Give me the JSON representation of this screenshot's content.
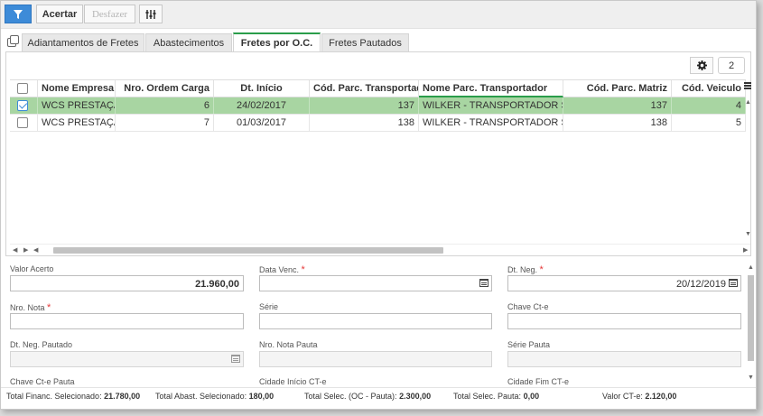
{
  "toolbar": {
    "filter_icon": "filter-icon",
    "acertar_label": "Acertar",
    "desfazer_label": "Desfazer",
    "columns_icon": "sliders-icon"
  },
  "tabs": [
    {
      "label": "Adiantamentos de Fretes",
      "active": false
    },
    {
      "label": "Abastecimentos",
      "active": false
    },
    {
      "label": "Fretes por O.C.",
      "active": true
    },
    {
      "label": "Fretes Pautados",
      "active": false
    }
  ],
  "grid": {
    "gear_icon": "gear-icon",
    "selected_count": "2",
    "columns": [
      "Nome Empresa",
      "Nro. Ordem Carga",
      "Dt. Início",
      "Cód. Parc. Transportador",
      "Nome Parc. Transportador",
      "Cód. Parc. Matriz",
      "Cód. Veiculo"
    ],
    "rows": [
      {
        "checked": true,
        "cells": [
          "WCS PRESTAÇÃO",
          "6",
          "24/02/2017",
          "137",
          "WILKER - TRANSPORTADOR SFRAN",
          "137",
          "4"
        ]
      },
      {
        "checked": false,
        "cells": [
          "WCS PRESTAÇÃO",
          "7",
          "01/03/2017",
          "138",
          "WILKER - TRANSPORTADOR SFRAN",
          "138",
          "5"
        ]
      }
    ]
  },
  "form": {
    "valor_acerto": {
      "label": "Valor Acerto",
      "value": "21.960,00"
    },
    "data_venc": {
      "label": "Data Venc.",
      "value": ""
    },
    "dt_neg": {
      "label": "Dt. Neg.",
      "value": "20/12/2019"
    },
    "nro_nota": {
      "label": "Nro. Nota",
      "value": ""
    },
    "serie": {
      "label": "Série",
      "value": ""
    },
    "chave_cte": {
      "label": "Chave Ct-e",
      "value": ""
    },
    "dt_neg_pautado": {
      "label": "Dt. Neg. Pautado",
      "value": ""
    },
    "nro_nota_pauta": {
      "label": "Nro. Nota Pauta",
      "value": ""
    },
    "serie_pauta": {
      "label": "Série Pauta",
      "value": ""
    },
    "chave_cte_pauta": {
      "label": "Chave Ct-e Pauta"
    },
    "cidade_inicio": {
      "label": "Cidade Início CT-e"
    },
    "cidade_fim": {
      "label": "Cidade Fim CT-e"
    },
    "required_mark": "*"
  },
  "footer": {
    "total_financ_label": "Total Financ. Selecionado:",
    "total_financ_value": "21.780,00",
    "total_abast_label": "Total Abast. Selecionado:",
    "total_abast_value": "180,00",
    "total_oc_label": "Total Selec. (OC - Pauta):",
    "total_oc_value": "2.300,00",
    "total_pauta_label": "Total Selec. Pauta:",
    "total_pauta_value": "0,00",
    "valor_cte_label": "Valor CT-e:",
    "valor_cte_value": "2.120,00"
  },
  "colors": {
    "accent_blue": "#3d8bd8",
    "active_green": "#2a9d4a",
    "row_selected": "#a8d5a2",
    "required_red": "#e53a3a"
  }
}
